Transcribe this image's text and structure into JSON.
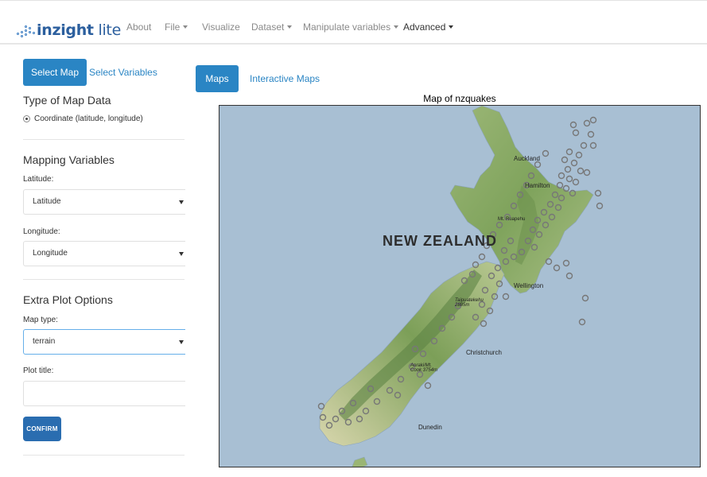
{
  "app": {
    "brand_main": "inzight",
    "brand_suffix": " lite"
  },
  "nav": {
    "items": [
      {
        "label": "About",
        "dropdown": false
      },
      {
        "label": "File",
        "dropdown": true
      },
      {
        "label": "Visualize",
        "dropdown": false
      },
      {
        "label": "Dataset",
        "dropdown": true
      },
      {
        "label": "Manipulate variables",
        "dropdown": true
      },
      {
        "label": "Advanced",
        "dropdown": true
      }
    ]
  },
  "sidebar": {
    "tabs": [
      {
        "label": "Select Map",
        "active": true
      },
      {
        "label": "Select Variables",
        "active": false
      }
    ],
    "map_type_section": {
      "title": "Type of Map Data",
      "option": "Coordinate (latitude, longitude)"
    },
    "mapping_section": {
      "title": "Mapping Variables",
      "latitude_label": "Latitude:",
      "latitude_value": "Latitude",
      "longitude_label": "Longitude:",
      "longitude_value": "Longitude"
    },
    "extra_section": {
      "title": "Extra Plot Options",
      "map_type_label": "Map type:",
      "map_type_value": "terrain",
      "plot_title_label": "Plot title:",
      "plot_title_value": "",
      "confirm_label": "CONFIRM"
    }
  },
  "main": {
    "tabs": [
      {
        "label": "Maps",
        "active": true
      },
      {
        "label": "Interactive Maps",
        "active": false
      }
    ],
    "map_title": "Map of nzquakes",
    "map": {
      "country_label": "NEW ZEALAND",
      "places": [
        "Auckland",
        "Hamilton",
        "Mt. Ruapehu",
        "Wellington",
        "Taipuatekehu 2885m",
        "Christchurch",
        "Aoraki/Mt. Cook 3754m",
        "Dunedin"
      ],
      "colors": {
        "sea": "#a8bfd3",
        "land_low": "#e6e2c0",
        "land_green": "#8fb06a",
        "land_dark": "#6f9452",
        "point": "#777777"
      }
    }
  }
}
